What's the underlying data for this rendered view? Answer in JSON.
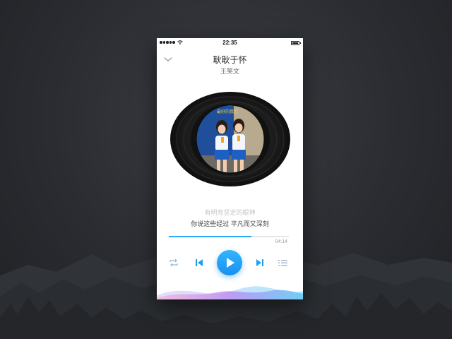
{
  "status_bar": {
    "time": "22:35"
  },
  "player": {
    "title": "耿耿于怀",
    "artist": "王笑文",
    "lyrics": {
      "previous": "有明亮坚定的眼神",
      "current": "你说这些经过 平凡而又深刻"
    },
    "progress": {
      "fraction": 0.69,
      "duration": "04:14"
    },
    "cover_text": "最好的我们"
  },
  "colors": {
    "accent": "#1e9ef4",
    "background": "#2a2c31",
    "disc": "#1a1a1a"
  },
  "icons": {
    "collapse": "chevron-down-icon",
    "repeat": "repeat-icon",
    "previous": "skip-previous-icon",
    "play": "play-icon",
    "next": "skip-next-icon",
    "playlist": "playlist-icon"
  }
}
